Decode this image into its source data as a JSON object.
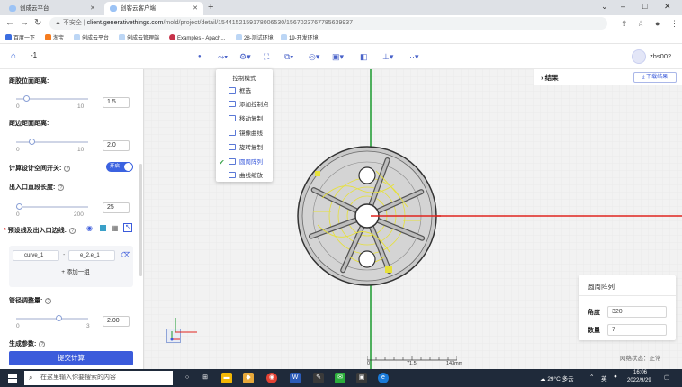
{
  "browser": {
    "tabs": [
      {
        "title": "创成云平台",
        "active": false
      },
      {
        "title": "创客云客户端",
        "active": true
      }
    ],
    "new_tab": "+",
    "window_controls": {
      "minimize": "–",
      "maximize": "□",
      "close": "✕",
      "collapse": "⌄"
    },
    "security_label": "不安全",
    "url_host": "client.generativethings.com",
    "url_path": "/mold/project/detail/1544152159178006530/1567023767785639937",
    "bookmarks": [
      "百度一下",
      "淘宝",
      "创成云平台",
      "创成云管理端",
      "Examples - Apach...",
      "28-测试环境",
      "19-开发环境"
    ]
  },
  "header": {
    "project_number": "-1",
    "username": "zhs002"
  },
  "left_panel": {
    "field1": {
      "label": "距胶位面距离:",
      "min": "0",
      "max": "10",
      "value": "1.5"
    },
    "field2": {
      "label": "距边距面距离:",
      "min": "0",
      "max": "10",
      "value": "2.0"
    },
    "switch": {
      "label": "计算设计空间开关:",
      "state": "开启"
    },
    "field3": {
      "label": "出入口直段长度:",
      "min": "0",
      "max": "200",
      "value": "25"
    },
    "preset": {
      "label": "预设线及出入口边线:",
      "required_mark": "*"
    },
    "curves": {
      "chip1": "curve_1",
      "sep": "-",
      "chip2": "e_2,e_1",
      "add_group": "+ 添加一组"
    },
    "field4": {
      "label": "管径调整量:",
      "min": "0",
      "max": "3",
      "value": "2.00"
    },
    "gen_params": {
      "label": "生成参数:"
    },
    "submit": "提交计算"
  },
  "dropdown": {
    "title": "控制模式",
    "items": [
      "框选",
      "添加控制点",
      "移动复制",
      "镜像曲线",
      "旋转复制",
      "圆周阵列",
      "曲线缩放"
    ],
    "selected_index": 5,
    "check": "✔"
  },
  "result_panel": {
    "title": "结果",
    "download": "下载结果"
  },
  "array_panel": {
    "title": "圆周阵列",
    "angle_label": "角度",
    "angle_value": "320",
    "count_label": "数量",
    "count_value": "7"
  },
  "network_status": "网络状态：正常",
  "scale": {
    "left": "0",
    "mid": "71.5",
    "right": "143mm"
  },
  "taskbar": {
    "search_placeholder": "在这里输入你要搜索的内容",
    "weather": "29°C 多云",
    "ime": "英",
    "time": "16:06",
    "date": "2022/9/29"
  },
  "colors": {
    "primary": "#3b5bdb",
    "x_axis": "#e0241f",
    "y_axis": "#1a9a2e",
    "curve": "#e6e03a"
  }
}
